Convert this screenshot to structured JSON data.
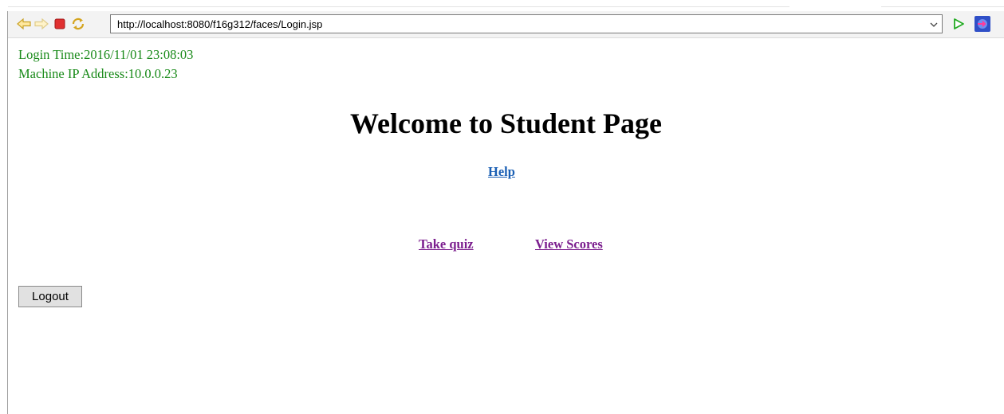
{
  "browser": {
    "url": "http://localhost:8080/f16g312/faces/Login.jsp",
    "icons": [
      "back-arrow-icon",
      "forward-arrow-icon",
      "stop-icon",
      "refresh-icon",
      "chevron-down-icon",
      "go-icon",
      "open-external-icon"
    ]
  },
  "session": {
    "login_time": "Login Time:2016/11/01 23:08:03",
    "ip_address": "Machine IP Address:10.0.0.23"
  },
  "page": {
    "title": "Welcome to Student Page",
    "help_link": "Help",
    "take_quiz_link": "Take quiz",
    "view_scores_link": "View Scores",
    "logout_button": "Logout"
  },
  "colors": {
    "info_text": "#198a19",
    "help_link": "#1a5fb4",
    "visited_link": "#7b1e8e",
    "go_green": "#22aa22",
    "stop_red": "#e03030"
  }
}
